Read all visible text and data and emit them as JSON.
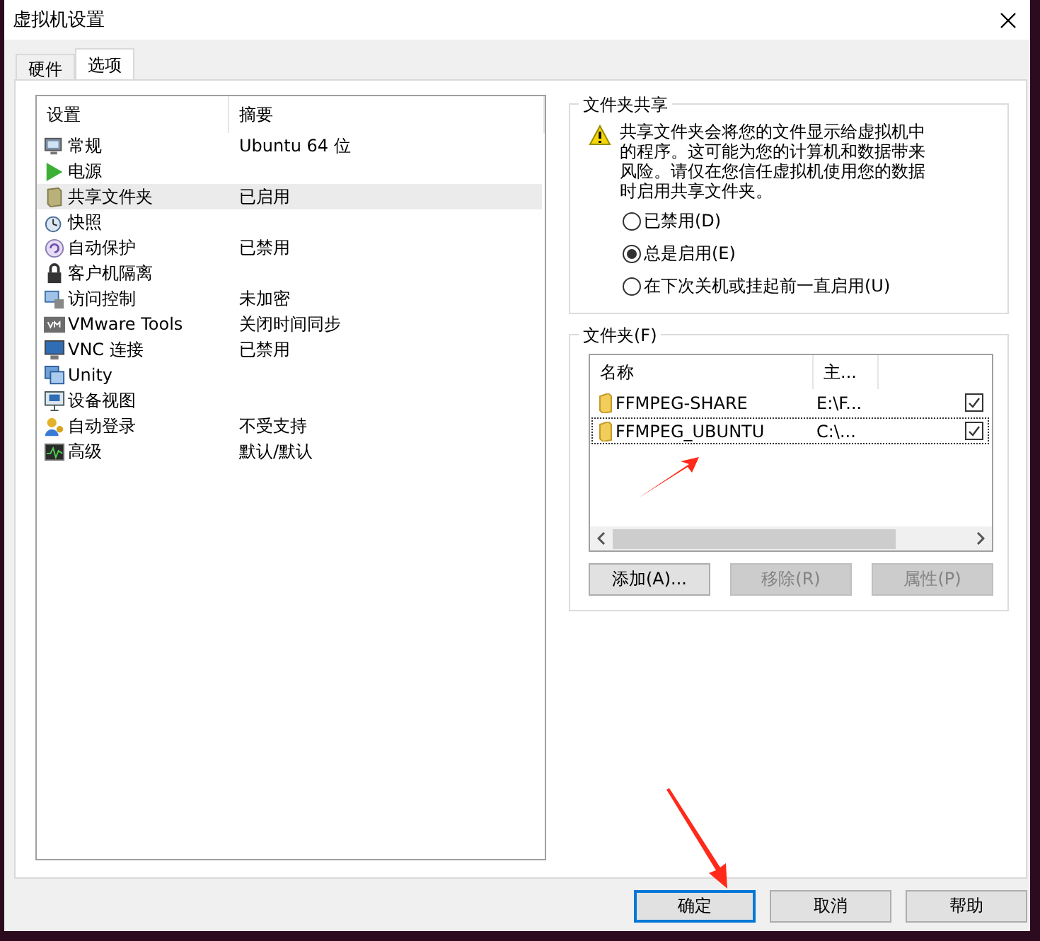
{
  "window": {
    "title": "虚拟机设置"
  },
  "tabs": [
    {
      "label": "硬件",
      "selected": false
    },
    {
      "label": "选项",
      "selected": true
    }
  ],
  "settings": {
    "columns": [
      "设置",
      "摘要"
    ],
    "rows": [
      {
        "name": "常规",
        "summary": "Ubuntu 64 位",
        "selected": false
      },
      {
        "name": "电源",
        "selected": false
      },
      {
        "name": "共享文件夹",
        "summary": "已启用",
        "selected": true
      },
      {
        "name": "快照",
        "selected": false
      },
      {
        "name": "自动保护",
        "summary": "已禁用",
        "selected": false
      },
      {
        "name": "客户机隔离",
        "selected": false
      },
      {
        "name": "访问控制",
        "summary": "未加密",
        "selected": false
      },
      {
        "name": "VMware Tools",
        "summary": "关闭时间同步",
        "selected": false
      },
      {
        "name": "VNC 连接",
        "summary": "已禁用",
        "selected": false
      },
      {
        "name": "Unity",
        "selected": false
      },
      {
        "name": "设备视图",
        "selected": false
      },
      {
        "name": "自动登录",
        "summary": "不受支持",
        "selected": false
      },
      {
        "name": "高级",
        "summary": "默认/默认",
        "selected": false
      }
    ]
  },
  "sharing": {
    "title": "文件夹共享",
    "warning": "共享文件夹会将您的文件显示给虚拟机中的程序。这可能为您的计算机和数据带来风险。请仅在您信任虚拟机使用您的数据时启用共享文件夹。",
    "options": [
      {
        "label": "已禁用(D)",
        "selected": false
      },
      {
        "label": "总是启用(E)",
        "selected": true
      },
      {
        "label": "在下次关机或挂起前一直启用(U)",
        "selected": false
      }
    ]
  },
  "folders": {
    "title": "文件夹(F)",
    "columns": [
      "名称",
      "主..."
    ],
    "rows": [
      {
        "name": "FFMPEG-SHARE",
        "path": "E:\\F...",
        "checked": true,
        "focused": false
      },
      {
        "name": "FFMPEG_UBUNTU",
        "path": "C:\\...",
        "checked": true,
        "focused": true
      }
    ],
    "buttons": [
      {
        "label": "添加(A)...",
        "disabled": false
      },
      {
        "label": "移除(R)",
        "disabled": true
      },
      {
        "label": "属性(P)",
        "disabled": true
      }
    ]
  },
  "dialog_buttons": [
    {
      "label": "确定",
      "default": true
    },
    {
      "label": "取消",
      "default": false
    },
    {
      "label": "帮助",
      "default": false
    }
  ]
}
